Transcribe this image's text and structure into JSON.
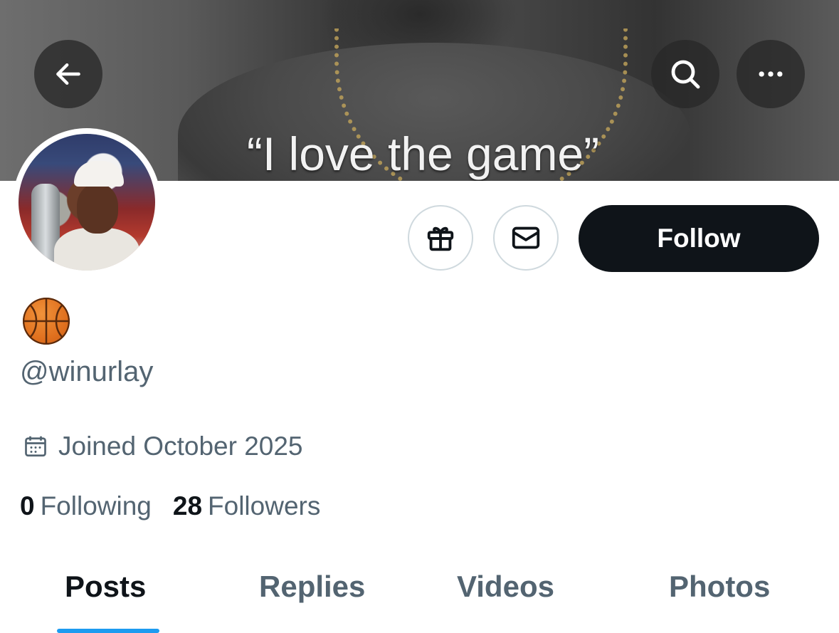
{
  "banner": {
    "quote": "“I love the game”"
  },
  "header": {
    "back_icon": "arrow-left-icon",
    "search_icon": "search-icon",
    "more_icon": "more-horizontal-icon"
  },
  "profile": {
    "display_name_emoji": "🏀",
    "handle": "@winurlay",
    "joined": "Joined October 2025",
    "following_count": "0",
    "following_label": "Following",
    "followers_count": "28",
    "followers_label": "Followers"
  },
  "actions": {
    "gift_icon": "gift-icon",
    "message_icon": "mail-icon",
    "follow_label": "Follow"
  },
  "tabs": [
    {
      "label": "Posts",
      "active": true
    },
    {
      "label": "Replies",
      "active": false
    },
    {
      "label": "Videos",
      "active": false
    },
    {
      "label": "Photos",
      "active": false
    }
  ],
  "colors": {
    "primary_text": "#0f1419",
    "secondary_text": "#536471",
    "accent": "#1d9bf0",
    "follow_bg": "#0f1419",
    "border": "#cfd9de"
  }
}
